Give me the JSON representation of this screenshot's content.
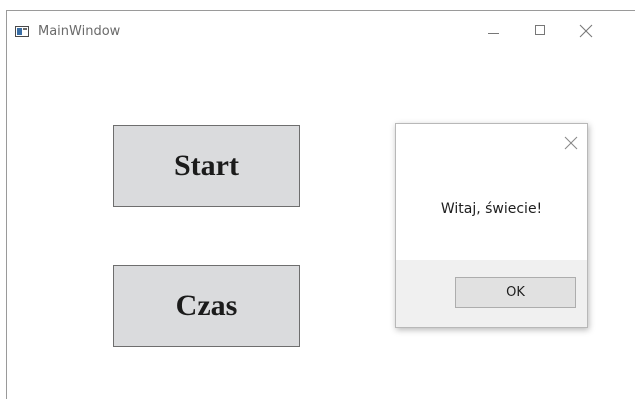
{
  "window": {
    "title": "MainWindow",
    "controls": {
      "minimize_icon": "minimize-icon",
      "maximize_icon": "maximize-icon",
      "close_icon": "close-icon"
    }
  },
  "main": {
    "start_label": "Start",
    "czas_label": "Czas"
  },
  "message_box": {
    "message": "Witaj, świecie!",
    "ok_label": "OK",
    "close_icon": "close-icon"
  },
  "colors": {
    "button_face": "#dadbdd",
    "dialog_footer": "#f0f0f0",
    "title_text": "#6a6a6a"
  }
}
